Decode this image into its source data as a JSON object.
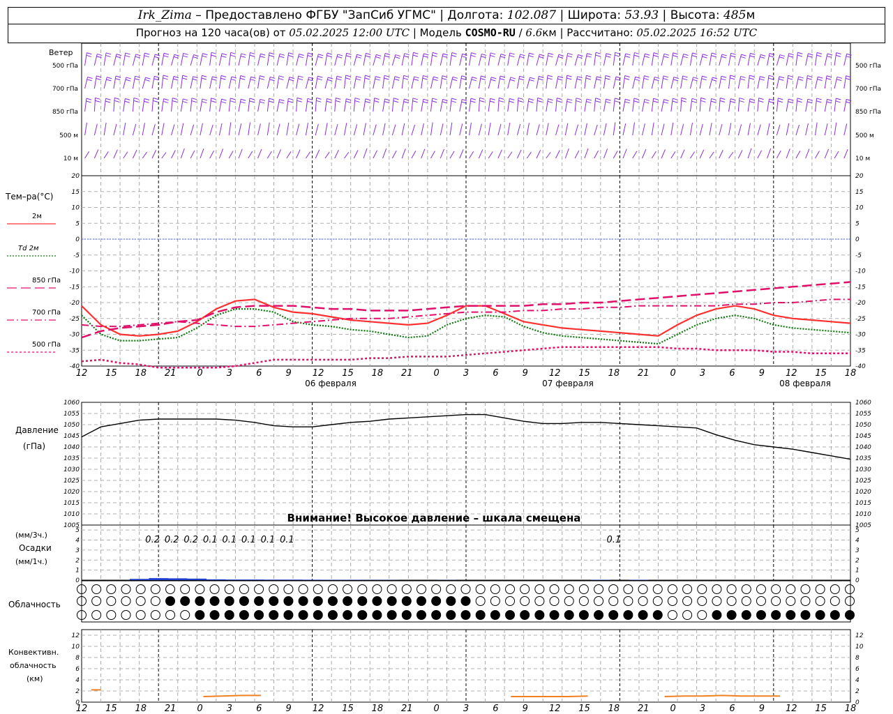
{
  "header": {
    "station": "Irk_Zima",
    "provider_prefix": " – Предоставлено ФГБУ \"ЗапСиб УГМС\" | Долгота: ",
    "lon": "102.087",
    "lat_prefix": " | Широта: ",
    "lat": "53.93",
    "alt_prefix": " | Высота: ",
    "alt": "485",
    "alt_unit": "м",
    "forecast_prefix": "Прогноз на 120 часа(ов) от ",
    "run_time": "05.02.2025 12:00 UTC",
    "model_prefix": " | Модель ",
    "model": "COSMO-RU",
    "model_res_sep": " / ",
    "model_res": "6.6",
    "model_res_unit": "км",
    "calc_prefix": " | Рассчитано: ",
    "calc_time": "05.02.2025 16:52 UTC"
  },
  "wind_panel": {
    "title": "Ветер",
    "levels": [
      "500 гПа",
      "700 гПа",
      "850 гПа",
      "500 м",
      "10 м"
    ],
    "barb_color": "#8a2be2"
  },
  "time_axis": {
    "hour_labels": [
      "12",
      "15",
      "18",
      "21",
      "0",
      "3",
      "6",
      "9",
      "12",
      "15",
      "18",
      "21",
      "0",
      "3",
      "6",
      "9",
      "12",
      "15",
      "18",
      "21",
      "0",
      "3",
      "6",
      "9",
      "12",
      "15",
      "18"
    ],
    "day_labels": [
      "06 февраля",
      "07 февраля",
      "08 февраля"
    ]
  },
  "temp_panel": {
    "title": "Тем–ра(°С)",
    "legend": [
      {
        "label": "2м",
        "color": "#ff3030",
        "style": "solid"
      },
      {
        "label": "Td 2м",
        "color": "#0a7a0a",
        "style": "dotted"
      },
      {
        "label": "850 гПа",
        "color": "#e0106a",
        "style": "dash"
      },
      {
        "label": "700 гПа",
        "color": "#e0106a",
        "style": "dashdot"
      },
      {
        "label": "500 гПа",
        "color": "#e0106a",
        "style": "dot"
      }
    ],
    "yticks": [
      "20",
      "15",
      "10",
      "5",
      "0",
      "-5",
      "-10",
      "-15",
      "-20",
      "-25",
      "-30",
      "-35",
      "-40"
    ]
  },
  "pressure_panel": {
    "title1": "Давление",
    "title2": "(гПа)",
    "yticks": [
      "1060",
      "1055",
      "1050",
      "1045",
      "1040",
      "1035",
      "1030",
      "1025",
      "1020",
      "1015",
      "1010",
      "1005"
    ],
    "warning": "Внимание! Высокое давление – шкала смещена"
  },
  "precip_panel": {
    "label1": "(мм/3ч.)",
    "label2": "Осадки",
    "label3": "(мм/1ч.)",
    "yticks": [
      "5",
      "4",
      "3",
      "2",
      "1",
      "0"
    ],
    "amounts": [
      {
        "hour": 9,
        "text": "0.2"
      },
      {
        "hour": 12,
        "text": "0.2"
      },
      {
        "hour": 15,
        "text": "0.2"
      },
      {
        "hour": 18,
        "text": "0.1"
      },
      {
        "hour": 21,
        "text": "0.1"
      },
      {
        "hour": 24,
        "text": "0.1"
      },
      {
        "hour": 27,
        "text": "0.1"
      },
      {
        "hour": 30,
        "text": "0.1"
      },
      {
        "hour": 81,
        "text": "0.1"
      }
    ]
  },
  "cloud_panel": {
    "title": "Облачность"
  },
  "conv_panel": {
    "label1": "Конвективн.",
    "label2": "облачность",
    "label3": "(км)",
    "yticks": [
      "12",
      "10",
      "8",
      "6",
      "4",
      "2",
      "0"
    ],
    "color": "#f08020"
  },
  "chart_data": [
    {
      "type": "line",
      "title": "Тем–ра(°С)",
      "x_hours": [
        0,
        3,
        6,
        9,
        12,
        15,
        18,
        21,
        24,
        27,
        30,
        33,
        36,
        39,
        42,
        45,
        48,
        51,
        54,
        57,
        60,
        63,
        66,
        69,
        72,
        75,
        78,
        81,
        84,
        87,
        90,
        93,
        96,
        99,
        102,
        105,
        108,
        111,
        114,
        117,
        120
      ],
      "ylim": [
        -40,
        20
      ],
      "series": [
        {
          "name": "2м",
          "values": [
            -21,
            -27,
            -30,
            -30.5,
            -30,
            -29,
            -26,
            -22,
            -19.5,
            -19,
            -21.5,
            -23,
            -23.5,
            -24.5,
            -25.5,
            -26,
            -26.5,
            -27,
            -26.5,
            -24,
            -21,
            -21,
            -23.5,
            -26,
            -27,
            -28,
            -28.5,
            -29,
            -29.5,
            -30,
            -30.5,
            -27,
            -24,
            -22,
            -21,
            -22,
            -24,
            -25,
            -25.5,
            -26,
            -26.5
          ]
        },
        {
          "name": "Td 2м",
          "values": [
            -24,
            -30,
            -32,
            -32,
            -31.5,
            -31,
            -28,
            -24,
            -22,
            -22,
            -23,
            -26,
            -27,
            -27.5,
            -28.5,
            -29,
            -30,
            -31,
            -30.5,
            -27,
            -25,
            -24,
            -24.5,
            -27.5,
            -29.5,
            -30.5,
            -31,
            -31.5,
            -32,
            -32.5,
            -33,
            -30,
            -27,
            -25,
            -24,
            -25,
            -27,
            -28,
            -28.5,
            -29,
            -29.5
          ]
        },
        {
          "name": "850 гПа",
          "values": [
            -31,
            -29,
            -28,
            -27.5,
            -27,
            -26,
            -25.5,
            -23,
            -21.5,
            -21,
            -21,
            -21,
            -21.5,
            -22,
            -22,
            -22.5,
            -22.5,
            -22.5,
            -22,
            -21.5,
            -21,
            -21,
            -21,
            -21,
            -20.5,
            -20.5,
            -20,
            -20,
            -19.5,
            -19,
            -18.5,
            -18,
            -17.5,
            -17,
            -16.5,
            -16,
            -15.5,
            -15,
            -14.5,
            -14,
            -13.5
          ]
        },
        {
          "name": "700 гПа",
          "values": [
            -27,
            -27.5,
            -27.5,
            -27,
            -26.5,
            -26,
            -26.5,
            -27,
            -27.5,
            -27.5,
            -27,
            -26.5,
            -26,
            -25.5,
            -25,
            -25,
            -25,
            -24.5,
            -24,
            -23.5,
            -23,
            -23,
            -23,
            -22.5,
            -22.5,
            -22,
            -22,
            -21.5,
            -21.5,
            -21,
            -21,
            -21,
            -21,
            -21,
            -20.5,
            -20.5,
            -20,
            -20,
            -19.5,
            -19,
            -19
          ]
        },
        {
          "name": "500 гПа",
          "values": [
            -38.5,
            -38,
            -39,
            -39.5,
            -40.5,
            -41.5,
            -41.5,
            -41,
            -40,
            -39,
            -38,
            -38,
            -38,
            -38,
            -38,
            -37.5,
            -37.5,
            -37,
            -37,
            -37,
            -36.5,
            -36,
            -35.5,
            -35,
            -34.5,
            -34,
            -34,
            -34,
            -34,
            -34,
            -34,
            -34.5,
            -34.5,
            -35,
            -35,
            -35,
            -35.5,
            -35.5,
            -36,
            -36,
            -36
          ]
        }
      ]
    },
    {
      "type": "line",
      "title": "Давление",
      "ylabel": "(гПа)",
      "x_hours": [
        0,
        3,
        6,
        9,
        12,
        15,
        18,
        21,
        24,
        27,
        30,
        33,
        36,
        39,
        42,
        45,
        48,
        51,
        54,
        57,
        60,
        63,
        66,
        69,
        72,
        75,
        78,
        81,
        84,
        87,
        90,
        93,
        96,
        99,
        102,
        105,
        108,
        111,
        114,
        117,
        120
      ],
      "ylim": [
        1005,
        1060
      ],
      "series": [
        {
          "name": "Давление",
          "values": [
            1044.5,
            1049,
            1050.5,
            1052,
            1052.5,
            1052.5,
            1052.5,
            1052.5,
            1052,
            1051,
            1049.5,
            1049,
            1049,
            1050,
            1051,
            1051.5,
            1052.5,
            1053,
            1053.5,
            1054,
            1054.5,
            1054.5,
            1053,
            1051.5,
            1050.5,
            1050.5,
            1051,
            1051,
            1050.5,
            1050,
            1049.5,
            1049,
            1048.5,
            1045.5,
            1043,
            1041,
            1040,
            1039,
            1037.5,
            1036,
            1034.5
          ]
        }
      ]
    },
    {
      "type": "bar",
      "title": "Осадки",
      "ylabel": "(мм/1ч.)",
      "x_hours": [
        9,
        12,
        15,
        18,
        21,
        24,
        27,
        30,
        33,
        36,
        39,
        42,
        45,
        48,
        51,
        54,
        57,
        60,
        63,
        66,
        69,
        72,
        75,
        78,
        81,
        84,
        87
      ],
      "ylim": [
        0,
        5
      ],
      "values": [
        0.12,
        0.2,
        0.18,
        0.15,
        0.08,
        0.06,
        0.06,
        0.05,
        0.05,
        0.04,
        0.03,
        0.03,
        0.02,
        0.02,
        0,
        0,
        0.02,
        0,
        0,
        0,
        0,
        0,
        0,
        0,
        0.03,
        0,
        0.03
      ]
    },
    {
      "type": "line",
      "title": "Конвективн. облачность",
      "ylabel": "(км)",
      "ylim": [
        0,
        13
      ],
      "segments": [
        {
          "x_hours": [
            1.5,
            3
          ],
          "values": [
            2.2,
            2.2
          ]
        },
        {
          "x_hours": [
            19,
            22,
            25,
            28
          ],
          "values": [
            1,
            1.1,
            1.2,
            1.2
          ]
        },
        {
          "x_hours": [
            67,
            70,
            73,
            76,
            79
          ],
          "values": [
            1,
            1,
            1,
            1,
            1.1
          ]
        },
        {
          "x_hours": [
            91,
            94,
            97,
            100,
            103,
            106,
            109
          ],
          "values": [
            1,
            1.1,
            1.1,
            1.2,
            1.1,
            1.1,
            1.1
          ]
        }
      ]
    }
  ]
}
